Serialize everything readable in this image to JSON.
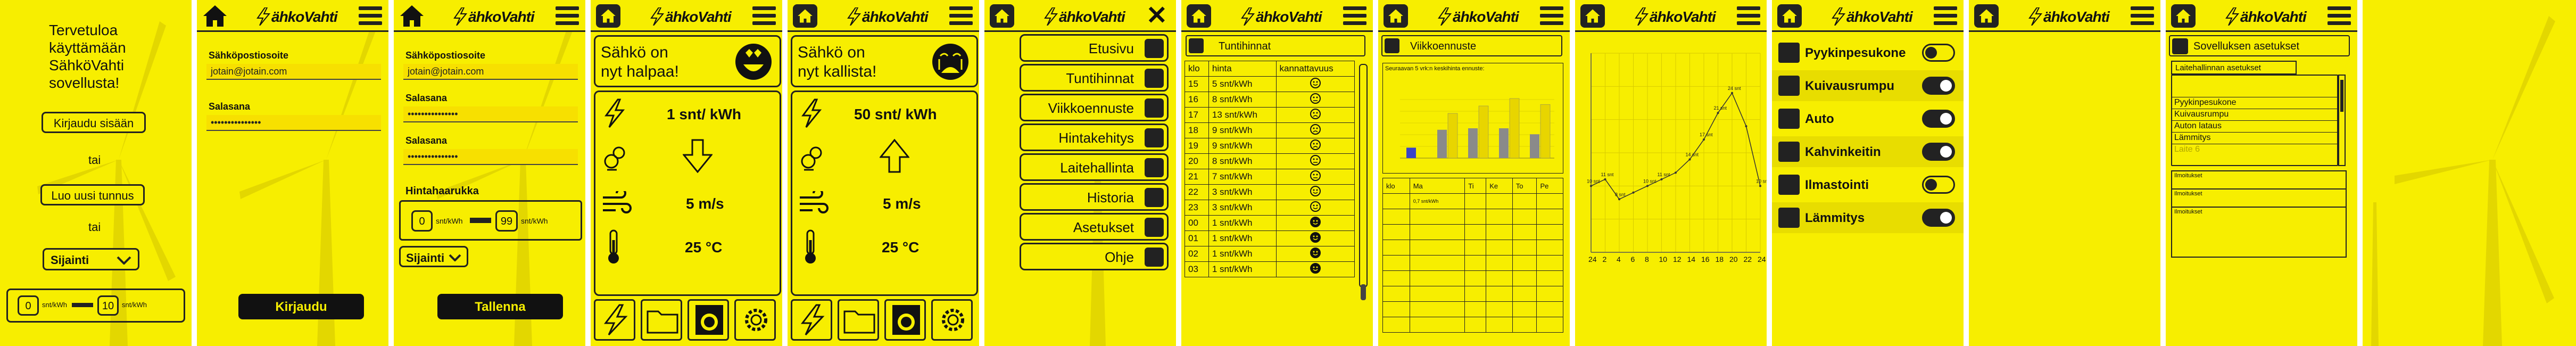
{
  "app_name": "ähkoVahti",
  "welcome": {
    "title_lines": [
      "Tervetuloa",
      "käyttämään",
      "SähköVahti",
      "sovellusta!"
    ],
    "login_button": "Kirjaudu sisään",
    "or1": "tai",
    "create_button": "Luo uusi tunnus",
    "or2": "tai",
    "location_button": "Sijainti",
    "range_min": "0",
    "range_max": "10",
    "range_unit": "snt/kWh"
  },
  "login": {
    "email_label": "Sähköpostiosoite",
    "email_value": "jotain@jotain.com",
    "password_label": "Salasana",
    "password_value": "•••••••••••••••",
    "submit_button": "Kirjaudu"
  },
  "register": {
    "email_label": "Sähköpostiosoite",
    "email_value": "jotain@jotain.com",
    "password_label": "Salasana",
    "password_value": "•••••••••••••••",
    "password2_label": "Salasana",
    "password2_value": "•••••••••••••••",
    "range_label": "Hintahaarukka",
    "range_min": "0",
    "range_max": "99",
    "range_unit": "snt/kWh",
    "location_button": "Sijainti",
    "save_button": "Tallenna"
  },
  "cheap": {
    "headline_lines": [
      "Sähkö on",
      "nyt halpaa!"
    ],
    "price": "1 snt/ kWh",
    "wind": "5 m/s",
    "temp": "25 °C"
  },
  "expensive": {
    "headline_lines": [
      "Sähkö on",
      "nyt kallista!"
    ],
    "price": "50 snt/ kWh",
    "wind": "5 m/s",
    "temp": "25 °C"
  },
  "menu": {
    "items": [
      "Etusivu",
      "Tuntihinnat",
      "Viikkoennuste",
      "Hintakehitys",
      "Laitehallinta",
      "Historia",
      "Asetukset",
      "Ohje"
    ]
  },
  "hourly": {
    "title": "Tuntihinnat",
    "headers": [
      "klo",
      "hinta",
      "kannattavuus"
    ],
    "rows": [
      {
        "klo": "15",
        "hinta": "5 snt/kWh",
        "face": "smile"
      },
      {
        "klo": "16",
        "hinta": "8 snt/kWh",
        "face": "meh"
      },
      {
        "klo": "17",
        "hinta": "13 snt/kWh",
        "face": "sad"
      },
      {
        "klo": "18",
        "hinta": "9 snt/kWh",
        "face": "sad"
      },
      {
        "klo": "19",
        "hinta": "9 snt/kWh",
        "face": "sad"
      },
      {
        "klo": "20",
        "hinta": "8 snt/kWh",
        "face": "meh"
      },
      {
        "klo": "21",
        "hinta": "7 snt/kWh",
        "face": "meh"
      },
      {
        "klo": "22",
        "hinta": "3 snt/kWh",
        "face": "smile"
      },
      {
        "klo": "23",
        "hinta": "3 snt/kWh",
        "face": "smile"
      },
      {
        "klo": "00",
        "hinta": "1 snt/kWh",
        "face": "cool"
      },
      {
        "klo": "01",
        "hinta": "1 snt/kWh",
        "face": "cool"
      },
      {
        "klo": "02",
        "hinta": "1 snt/kWh",
        "face": "cool"
      },
      {
        "klo": "03",
        "hinta": "1 snt/kWh",
        "face": "cool"
      }
    ]
  },
  "weekly": {
    "title": "Viikkoennuste",
    "chart_title": "Seuraavan 5 vrk:n keskihinta ennuste:",
    "table_headers": [
      "klo",
      "Ma",
      "Ti",
      "Ke",
      "To",
      "Pe"
    ],
    "first_cell": "0,7 snt/kWh"
  },
  "trend": {
    "chart_data": {
      "type": "line",
      "x": [
        "24",
        "2",
        "4",
        "6",
        "8",
        "10",
        "12",
        "14",
        "16",
        "18",
        "20",
        "22",
        "24"
      ],
      "series": [
        {
          "values": [
            10,
            11,
            8,
            9,
            10,
            11,
            12,
            14,
            17,
            21,
            24,
            19,
            10
          ]
        }
      ],
      "point_labels": [
        "10 snt",
        "11 snt",
        "8 snt",
        "",
        "10 snt",
        "11 snt",
        "",
        "14 snt",
        "17 snt",
        "21 snt",
        "24 snt",
        "",
        "10 snt"
      ],
      "ylim": [
        0,
        30
      ]
    }
  },
  "devices": {
    "items": [
      {
        "label": "Pyykinpesukone",
        "on": false
      },
      {
        "label": "Kuivausrumpu",
        "on": true
      },
      {
        "label": "Auto",
        "on": true
      },
      {
        "label": "Kahvinkeitin",
        "on": true
      },
      {
        "label": "Ilmastointi",
        "on": false
      },
      {
        "label": "Lämmitys",
        "on": true
      }
    ]
  },
  "settings": {
    "title": "Sovelluksen asetukset",
    "tab": "Laitehallinnan asetukset",
    "list": [
      "Pyykinpesukone",
      "Kuivausrumpu",
      "Auton lataus",
      "Lämmitys",
      "Laite 6"
    ],
    "section_labels": [
      "Ilmoitukset",
      "Ilmoitukset",
      "Ilmoitukset"
    ]
  },
  "colors": {
    "brand": "#f7ee00",
    "ink": "#222222",
    "bar_blue": "#3a44c8",
    "bar_grey": "#8a8a8a",
    "bar_yellow": "#e8d500"
  }
}
